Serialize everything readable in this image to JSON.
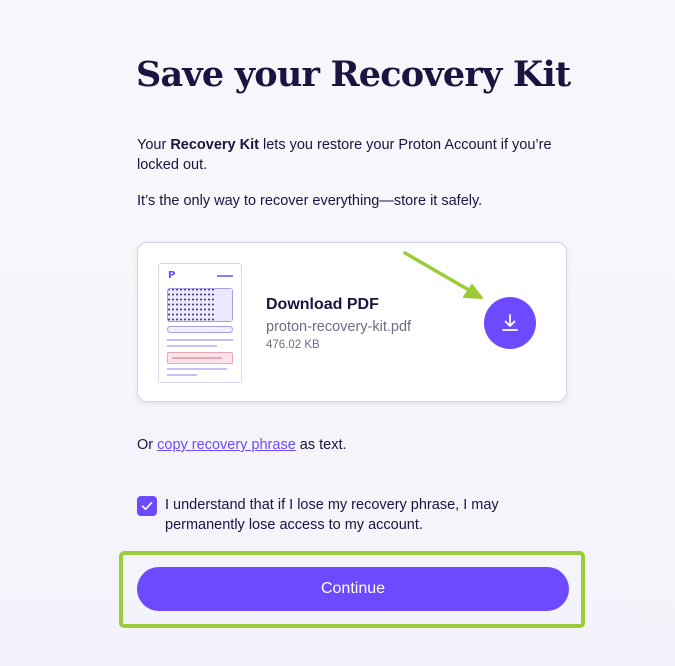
{
  "title": "Save your Recovery Kit",
  "intro": {
    "prefix": "Your ",
    "bold": "Recovery Kit",
    "suffix": " lets you restore your Proton Account if you’re locked out."
  },
  "note": "It’s the only way to recover everything—store it safely.",
  "kit": {
    "heading": "Download PDF",
    "filename": "proton-recovery-kit.pdf",
    "size": "476.02 KB",
    "thumbnail_logo": "P",
    "download_icon": "download-icon"
  },
  "alt_option": {
    "prefix": "Or ",
    "link": "copy recovery phrase",
    "suffix": " as text."
  },
  "acknowledgement": {
    "checked": true,
    "text": "I understand that if I lose my recovery phrase, I may permanently lose access to my account."
  },
  "continue_label": "Continue",
  "colors": {
    "accent": "#6d4aff",
    "annotation": "#9ccc3a",
    "text": "#1b1340",
    "muted": "#6f6b85"
  }
}
